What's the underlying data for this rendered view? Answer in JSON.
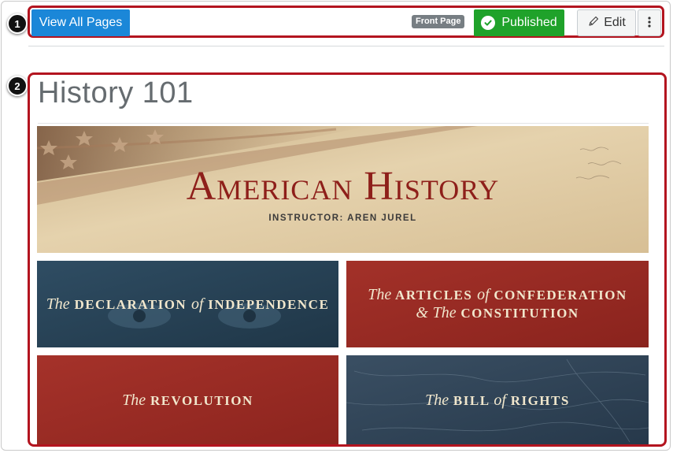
{
  "toolbar": {
    "view_all_label": "View All Pages",
    "front_page_badge": "Front Page",
    "published_label": "Published",
    "edit_label": "Edit"
  },
  "callouts": [
    "1",
    "2"
  ],
  "page": {
    "title": "History 101"
  },
  "banner": {
    "title": "American History",
    "subtitle": "INSTRUCTOR: AREN JUREL"
  },
  "tiles": [
    {
      "the": "The",
      "l1a": "DECLARATION",
      "of": "of",
      "l1b": "INDEPENDENCE"
    },
    {
      "the1": "The",
      "l1a": "ARTICLES",
      "of": "of",
      "l1b": "CONFEDERATION",
      "amp": "&",
      "the2": "The",
      "l2": "CONSTITUTION"
    },
    {
      "the": "The",
      "l1": "REVOLUTION"
    },
    {
      "the": "The",
      "l1a": "BILL",
      "of": "of",
      "l1b": "RIGHTS"
    }
  ],
  "colors": {
    "primary": "#1b87d8",
    "published": "#1fa22a",
    "callout_border": "#b3141f"
  }
}
